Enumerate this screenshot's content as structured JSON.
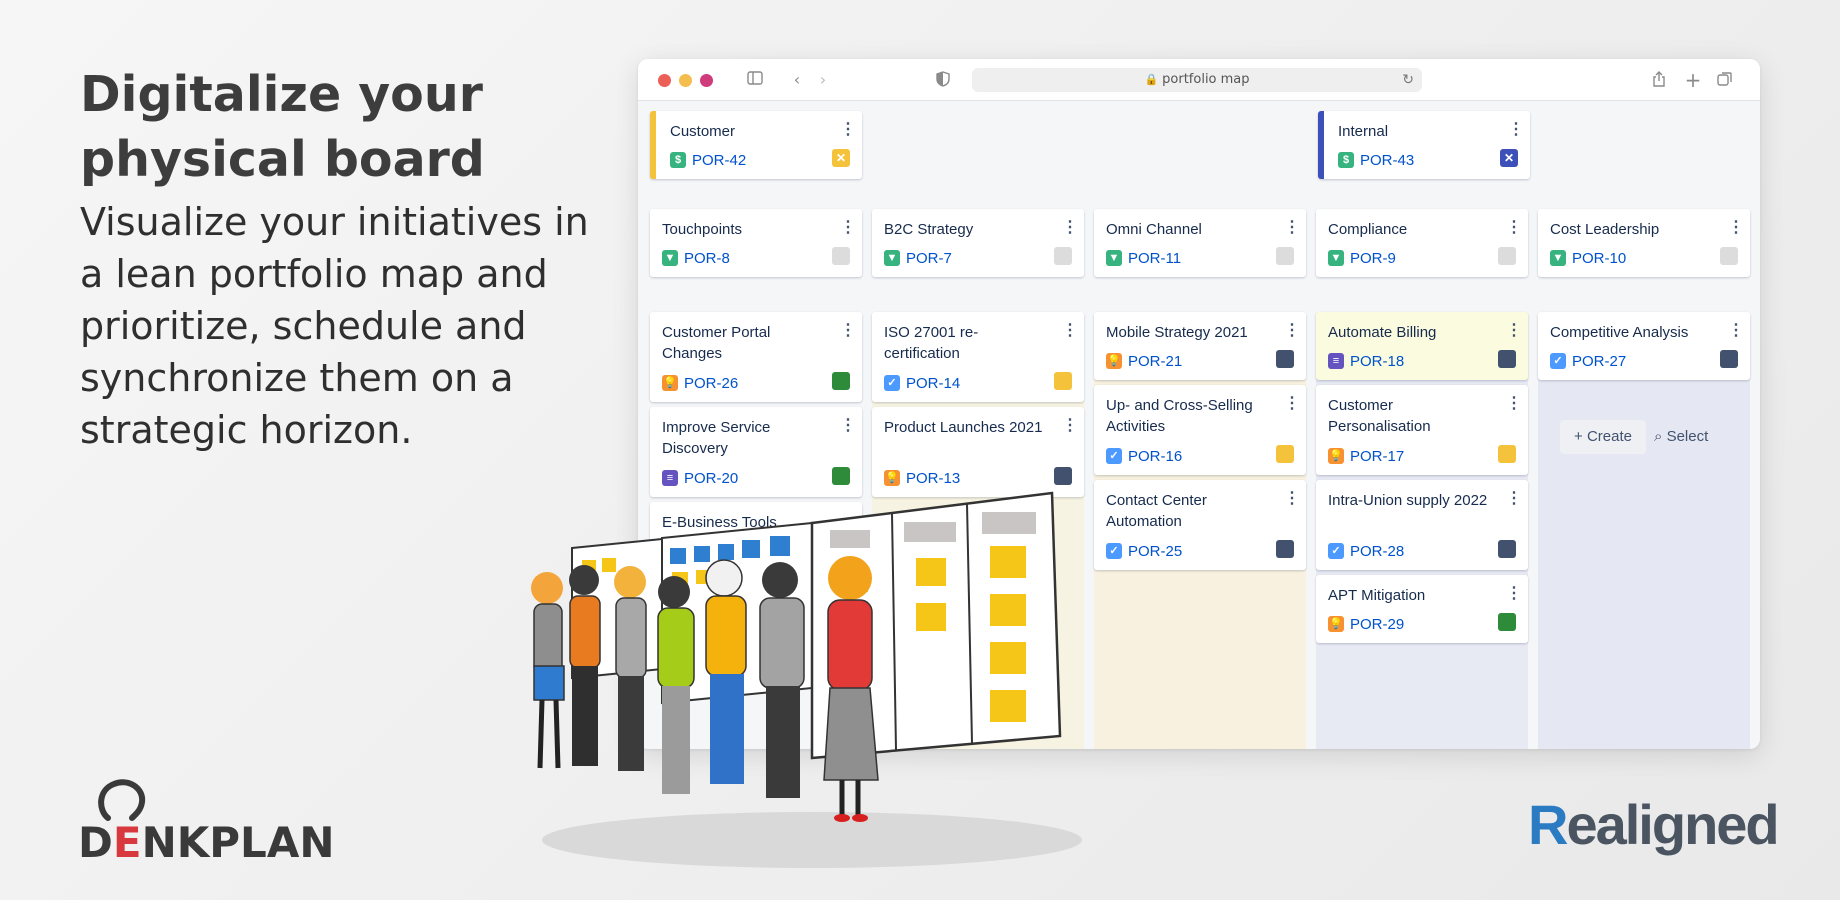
{
  "hero": {
    "title": "Digitalize your physical board",
    "text": "Visualize your initiatives in a lean portfolio map and prioritize, schedule and synchronize them on a strategic horizon."
  },
  "logos": {
    "left": {
      "before": "D",
      "accent": "E",
      "after": "NKPLAN"
    },
    "right": {
      "first": "R",
      "rest": "ealigned"
    }
  },
  "browser": {
    "url": "portfolio map",
    "traffic_lights": [
      "#ec5f57",
      "#f4be4f",
      "#cf3b7b"
    ]
  },
  "colors": {
    "type_money": "#36b37e",
    "type_bookmark": "#36b37e",
    "type_idea": "#f79232",
    "type_task": "#4c9aff",
    "type_doc": "#6554c0",
    "status_grey": "#dcdcdc",
    "status_yellow": "#f5c33b",
    "status_green": "#2e8b3a",
    "status_navy": "#42526e",
    "status_blue": "#3d4fb8"
  },
  "board": {
    "themes": [
      {
        "title": "Customer",
        "key": "POR-42",
        "type": "money",
        "status": "yellow",
        "status_glyph": "✕",
        "accent": "#f5c33b"
      },
      {
        "title": "Internal",
        "key": "POR-43",
        "type": "money",
        "status": "blue",
        "status_glyph": "✕",
        "accent": "#3d4fb8"
      }
    ],
    "strategies": [
      {
        "title": "Touchpoints",
        "key": "POR-8",
        "type": "bookmark",
        "status": "grey"
      },
      {
        "title": "B2C Strategy",
        "key": "POR-7",
        "type": "bookmark",
        "status": "grey"
      },
      {
        "title": "Omni Channel",
        "key": "POR-11",
        "type": "bookmark",
        "status": "grey"
      },
      {
        "title": "Compliance",
        "key": "POR-9",
        "type": "bookmark",
        "status": "grey"
      },
      {
        "title": "Cost Leadership",
        "key": "POR-10",
        "type": "bookmark",
        "status": "grey"
      }
    ],
    "initiatives": [
      {
        "title": "Customer Portal Changes",
        "key": "POR-26",
        "type": "idea",
        "status": "green"
      },
      {
        "title": "Improve Service Discovery",
        "key": "POR-20",
        "type": "doc",
        "status": "green"
      },
      {
        "title": "E-Business Tools",
        "key": "",
        "type": "",
        "status": ""
      },
      {
        "title": "ISO 27001 re-certification",
        "key": "POR-14",
        "type": "task",
        "status": "yellow"
      },
      {
        "title": "Product Launches 2021",
        "key": "POR-13",
        "type": "idea",
        "status": "navy"
      },
      {
        "title": "Mobile Strategy 2021",
        "key": "POR-21",
        "type": "idea",
        "status": "navy"
      },
      {
        "title": "Up- and Cross-Selling Activities",
        "key": "POR-16",
        "type": "task",
        "status": "yellow"
      },
      {
        "title": "Contact Center Automation",
        "key": "POR-25",
        "type": "task",
        "status": "navy"
      },
      {
        "title": "Automate Billing",
        "key": "POR-18",
        "type": "doc",
        "status": "navy"
      },
      {
        "title": "Customer Personalisation",
        "key": "POR-17",
        "type": "idea",
        "status": "yellow"
      },
      {
        "title": "Intra-Union supply 2022",
        "key": "POR-28",
        "type": "task",
        "status": "navy"
      },
      {
        "title": "APT Mitigation",
        "key": "POR-29",
        "type": "idea",
        "status": "green"
      },
      {
        "title": "Competitive Analysis",
        "key": "POR-27",
        "type": "task",
        "status": "navy"
      }
    ],
    "actions": {
      "create": "Create",
      "select": "Select"
    }
  }
}
